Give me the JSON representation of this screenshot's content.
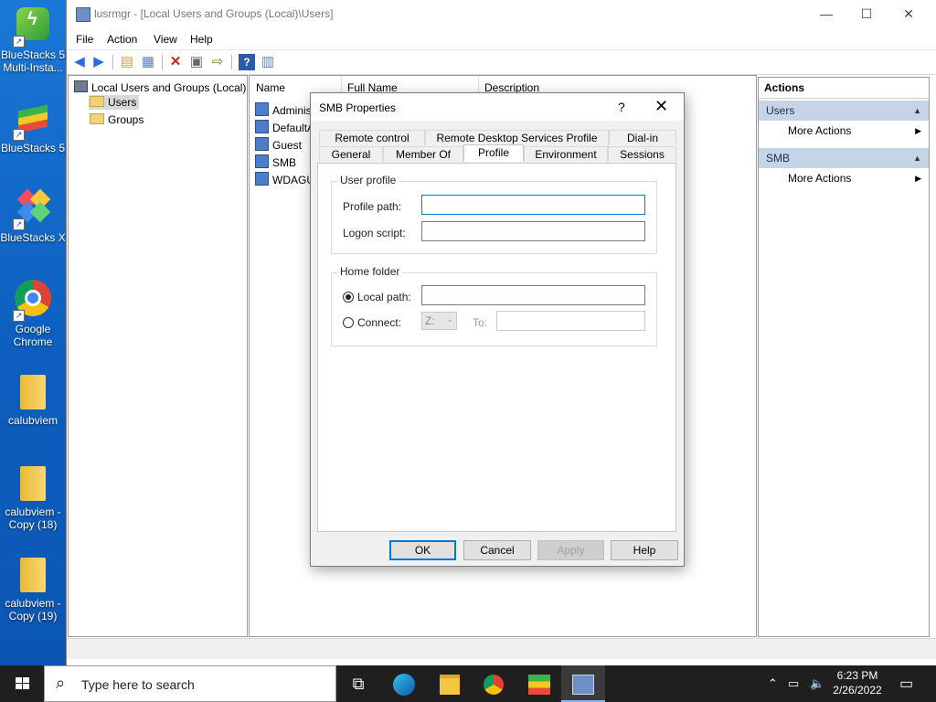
{
  "desktop": {
    "icons": [
      {
        "label": "BlueStacks 5 Multi-Insta...",
        "icon": "bluestacks-multi-icon"
      },
      {
        "label": "BlueStacks 5",
        "icon": "bluestacks-icon"
      },
      {
        "label": "BlueStacks X",
        "icon": "bluestacks-x-icon"
      },
      {
        "label": "Google Chrome",
        "icon": "chrome-icon"
      },
      {
        "label": "calubviem",
        "icon": "folder-icon"
      },
      {
        "label": "calubviem - Copy (18)",
        "icon": "folder-icon"
      },
      {
        "label": "calubviem - Copy (19)",
        "icon": "folder-icon"
      }
    ]
  },
  "window": {
    "title": "lusrmgr - [Local Users and Groups (Local)\\Users]",
    "controls": {
      "minimize": "—",
      "maximize": "☐",
      "close": "✕"
    },
    "menu": [
      "File",
      "Action",
      "View",
      "Help"
    ]
  },
  "tree": {
    "root": "Local Users and Groups (Local)",
    "children": [
      "Users",
      "Groups"
    ],
    "selected": "Users"
  },
  "list": {
    "columns": [
      "Name",
      "Full Name",
      "Description"
    ],
    "rows": [
      "Adminis",
      "DefaultA",
      "Guest",
      "SMB",
      "WDAGUt"
    ]
  },
  "actions": {
    "header": "Actions",
    "sections": [
      {
        "title": "Users",
        "items": [
          "More Actions"
        ]
      },
      {
        "title": "SMB",
        "items": [
          "More Actions"
        ]
      }
    ]
  },
  "dialog": {
    "title": "SMB Properties",
    "help_glyph": "?",
    "close_glyph": "✕",
    "tabs_row1": [
      "Remote control",
      "Remote Desktop Services Profile",
      "Dial-in"
    ],
    "tabs_row2": [
      "General",
      "Member Of",
      "Profile",
      "Environment",
      "Sessions"
    ],
    "active_tab": "Profile",
    "user_profile": {
      "group_label": "User profile",
      "profile_path_label": "Profile path:",
      "profile_path_value": "",
      "logon_script_label": "Logon script:",
      "logon_script_value": ""
    },
    "home_folder": {
      "group_label": "Home folder",
      "local_path_label": "Local path:",
      "local_path_value": "",
      "local_path_selected": true,
      "connect_label": "Connect:",
      "drive_value": "Z:",
      "to_label": "To:",
      "to_value": ""
    },
    "buttons": {
      "ok": "OK",
      "cancel": "Cancel",
      "apply": "Apply",
      "help": "Help"
    }
  },
  "taskbar": {
    "search_placeholder": "Type here to search",
    "time": "6:23 PM",
    "date": "2/26/2022"
  }
}
